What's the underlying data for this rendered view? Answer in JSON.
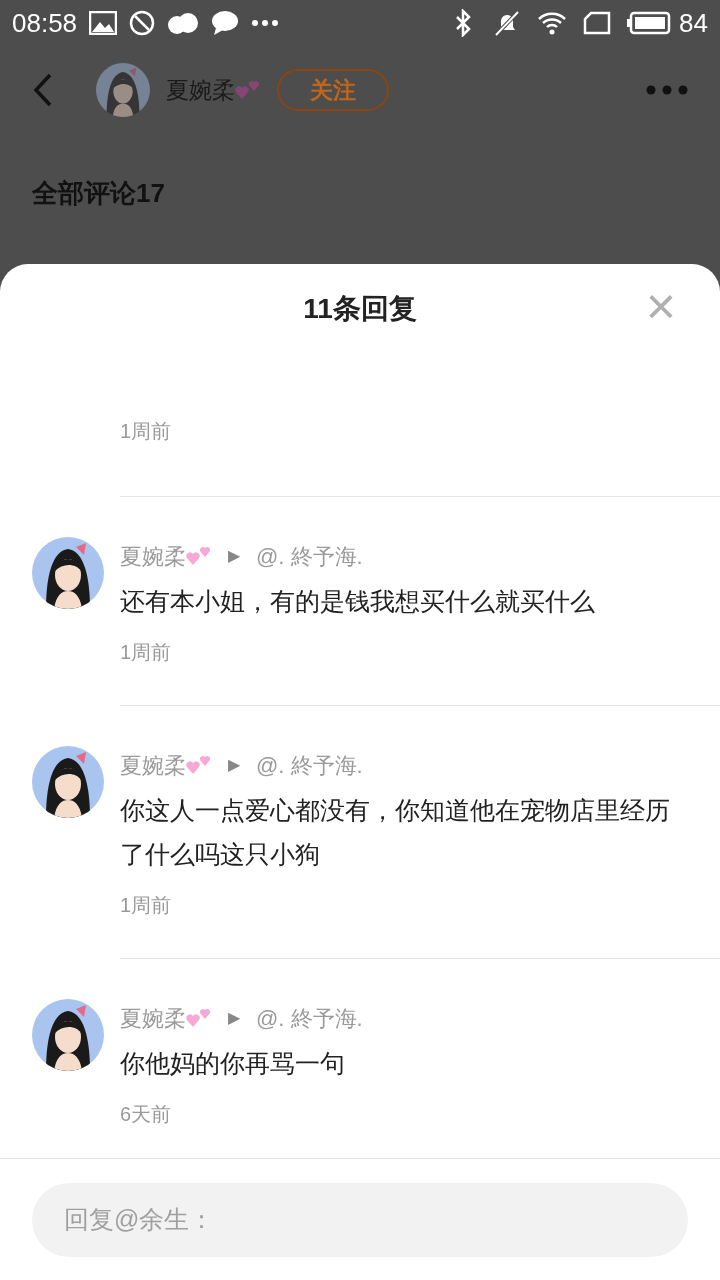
{
  "status_bar": {
    "time": "08:58",
    "battery": "84"
  },
  "header": {
    "author": "夏婉柔",
    "follow_button": "关注"
  },
  "background": {
    "section_title": "全部评论17"
  },
  "sheet": {
    "title": "11条回复",
    "close": "×",
    "replies": [
      {
        "kind": "partial",
        "time": "1周前"
      },
      {
        "kind": "full",
        "author": "夏婉柔",
        "arrow": "▶",
        "target": "@. 終予海.",
        "text": "还有本小姐，有的是钱我想买什么就买什么",
        "time": "1周前"
      },
      {
        "kind": "full",
        "author": "夏婉柔",
        "arrow": "▶",
        "target": "@. 終予海.",
        "text": "你这人一点爱心都没有，你知道他在宠物店里经历了什么吗这只小狗",
        "time": "1周前"
      },
      {
        "kind": "full",
        "author": "夏婉柔",
        "arrow": "▶",
        "target": "@. 終予海.",
        "text": "你他妈的你再骂一句",
        "time": "6天前"
      }
    ],
    "input": {
      "placeholder": "回复@余生："
    }
  }
}
